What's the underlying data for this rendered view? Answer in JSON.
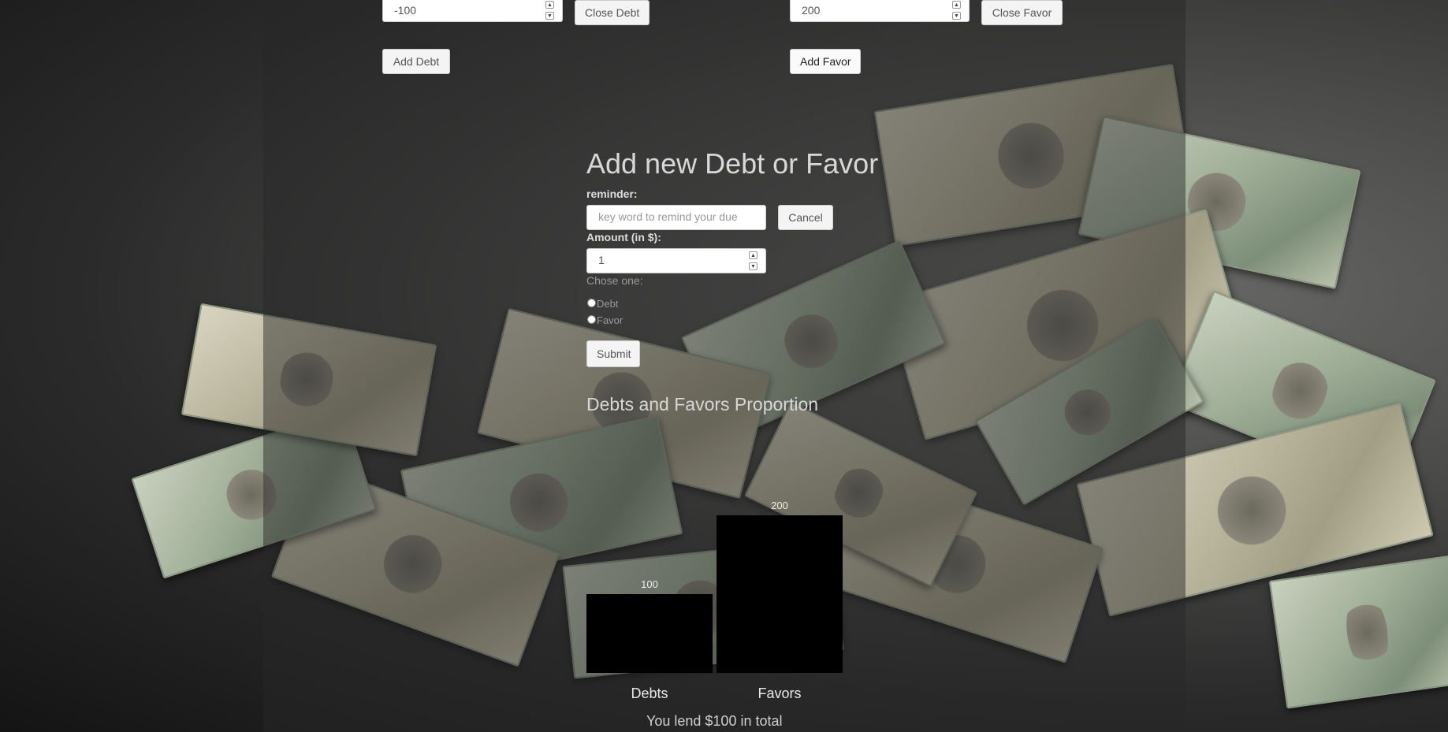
{
  "top_row": {
    "debt_amount_value": "-100",
    "close_debt_label": "Close Debt",
    "add_debt_label": "Add Debt",
    "favor_amount_value": "200",
    "close_favor_label": "Close Favor",
    "add_favor_label": "Add Favor"
  },
  "form": {
    "title": "Add new Debt or Favor",
    "reminder_label": "reminder:",
    "reminder_placeholder": "key word to remind your due",
    "cancel_label": "Cancel",
    "amount_label": "Amount (in $):",
    "amount_value": "1",
    "choose_label": "Chose one:",
    "options": [
      "Debt",
      "Favor"
    ],
    "submit_label": "Submit"
  },
  "chart_title": "Debts and Favors Proportion",
  "chart_data": {
    "type": "bar",
    "categories": [
      "Debts",
      "Favors"
    ],
    "values": [
      100,
      200
    ],
    "data_labels": [
      "100",
      "200"
    ],
    "title": "Debts and Favors Proportion",
    "bar_color": "#000000"
  },
  "summary_text": "You lend $100 in total",
  "colors": {
    "panel_overlay": "rgba(40,40,40,0.48)",
    "heading_text": "#d8d8d8"
  }
}
